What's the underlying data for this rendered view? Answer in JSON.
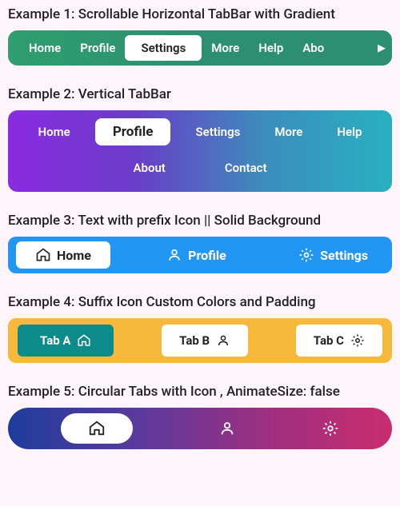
{
  "ex1": {
    "title": "Example 1: Scrollable Horizontal TabBar with Gradient",
    "tabs": [
      "Home",
      "Profile",
      "Settings",
      "More",
      "Help",
      "Abo"
    ],
    "activeIndex": 2
  },
  "ex2": {
    "title": "Example 2: Vertical TabBar",
    "row1": [
      "Home",
      "Profile",
      "Settings",
      "More",
      "Help"
    ],
    "row2": [
      "About",
      "Contact"
    ],
    "activeIndex": 1
  },
  "ex3": {
    "title": "Example 3: Text with prefix Icon || Solid Background",
    "tabs": [
      {
        "label": "Home",
        "icon": "home"
      },
      {
        "label": "Profile",
        "icon": "person"
      },
      {
        "label": "Settings",
        "icon": "settings"
      }
    ],
    "activeIndex": 0
  },
  "ex4": {
    "title": "Example 4: Suffix Icon Custom Colors and Padding",
    "tabs": [
      {
        "label": "Tab A",
        "icon": "home"
      },
      {
        "label": "Tab B",
        "icon": "person"
      },
      {
        "label": "Tab C",
        "icon": "settings"
      }
    ],
    "activeIndex": 0
  },
  "ex5": {
    "title": "Example 5: Circular Tabs with Icon , AnimateSize: false",
    "tabs": [
      {
        "icon": "home"
      },
      {
        "icon": "person"
      },
      {
        "icon": "settings"
      }
    ],
    "activeIndex": 0
  },
  "colors": {
    "ex1_gradient": [
      "#2f9e70",
      "#2c8f6f"
    ],
    "ex2_gradient": [
      "#8a2be2",
      "#29b0c0"
    ],
    "ex3_bg": "#2196f3",
    "ex4_bg": "#f6b93b",
    "ex4_active": "#0d8a8a",
    "ex5_gradient": [
      "#1e3c9b",
      "#c92d6f"
    ]
  }
}
